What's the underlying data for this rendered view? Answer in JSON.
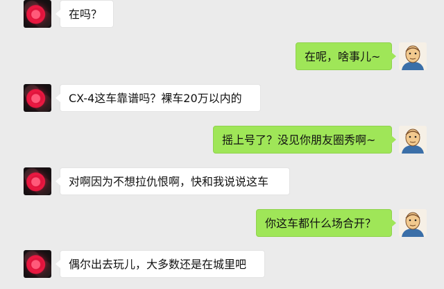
{
  "chat": {
    "messages": [
      {
        "sender": "contact",
        "text": "在吗？"
      },
      {
        "sender": "self",
        "text": "在呢，啥事儿~"
      },
      {
        "sender": "contact",
        "text": "CX-4这车靠谱吗？裸车20万以内的"
      },
      {
        "sender": "self",
        "text": "摇上号了？没见你朋友圈秀啊~"
      },
      {
        "sender": "contact",
        "text": "对啊因为不想拉仇恨啊，快和我说说这车"
      },
      {
        "sender": "self",
        "text": "你这车都什么场合开？"
      },
      {
        "sender": "contact",
        "text": "偶尔出去玩儿，大多数还是在城里吧"
      }
    ]
  },
  "colors": {
    "background": "#ebebeb",
    "self_bubble": "#9fe658",
    "contact_bubble": "#ffffff"
  },
  "icons": {
    "contact_avatar": "contact-avatar-icon",
    "self_avatar": "cartoon-man-avatar-icon"
  }
}
